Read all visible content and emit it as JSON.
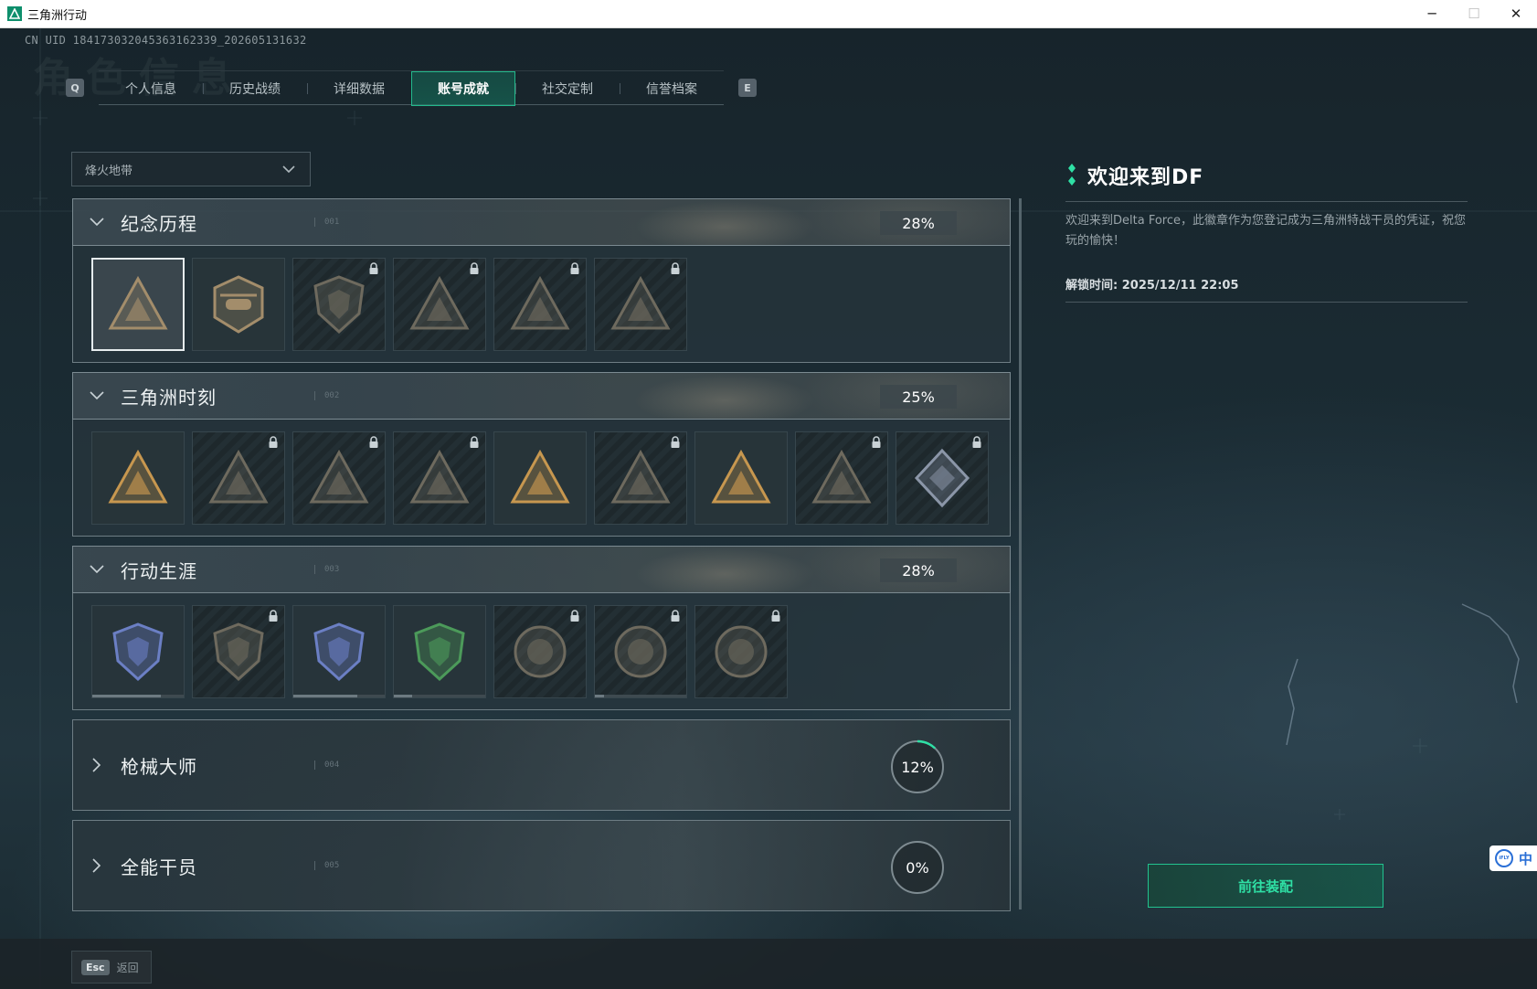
{
  "window": {
    "title": "三角洲行动",
    "controls": [
      "minimize",
      "maximize",
      "close"
    ]
  },
  "header": {
    "uid": "CN UID 184173032045363162339_202605131632",
    "watermark": "角色信息"
  },
  "tabs": {
    "prev_key": "Q",
    "next_key": "E",
    "items": [
      {
        "label": "个人信息",
        "active": false
      },
      {
        "label": "历史战绩",
        "active": false
      },
      {
        "label": "详细数据",
        "active": false
      },
      {
        "label": "账号成就",
        "active": true
      },
      {
        "label": "社交定制",
        "active": false
      },
      {
        "label": "信誉档案",
        "active": false
      }
    ]
  },
  "mode_select": {
    "value": "烽火地带"
  },
  "categories": [
    {
      "title": "纪念历程",
      "code": "001",
      "percent": "28%",
      "expanded": true,
      "badges": [
        {
          "icon": "delta-triangle-badge-icon",
          "locked": false,
          "selected": true,
          "color": "#a38d6b"
        },
        {
          "icon": "helicopter-badge-icon",
          "locked": false,
          "selected": false,
          "color": "#a38d6b"
        },
        {
          "icon": "diamond-shield-badge-icon",
          "locked": true,
          "color": "#6e6a5e"
        },
        {
          "icon": "gunner-badge-icon",
          "locked": true,
          "color": "#6e6a5e"
        },
        {
          "icon": "hooded-figure-badge-icon",
          "locked": true,
          "color": "#6e6a5e"
        },
        {
          "icon": "skull-crossed-rifles-badge-icon",
          "locked": true,
          "color": "#6e6a5e"
        }
      ]
    },
    {
      "title": "三角洲时刻",
      "code": "002",
      "percent": "25%",
      "expanded": true,
      "badges": [
        {
          "icon": "usb-drive-badge-icon",
          "locked": false,
          "color": "#c7974f"
        },
        {
          "icon": "robot-badge-icon",
          "locked": true,
          "color": "#6e6a5e"
        },
        {
          "icon": "kneeling-soldier-badge-icon",
          "locked": true,
          "color": "#6e6a5e"
        },
        {
          "icon": "sunburst-badge-icon",
          "locked": true,
          "color": "#6e6a5e"
        },
        {
          "icon": "hands-up-soldier-badge-icon",
          "locked": false,
          "color": "#c7974f"
        },
        {
          "icon": "wolf-badge-icon",
          "locked": true,
          "color": "#6e6a5e"
        },
        {
          "icon": "rocket-badge-icon",
          "locked": false,
          "color": "#c7974f"
        },
        {
          "icon": "fish-badge-icon",
          "locked": true,
          "color": "#6e6a5e"
        },
        {
          "icon": "dice-badge-icon",
          "locked": true,
          "color": "#8b96a8"
        }
      ]
    },
    {
      "title": "行动生涯",
      "code": "003",
      "percent": "28%",
      "expanded": true,
      "badges": [
        {
          "icon": "star-shield-badge-icon",
          "locked": false,
          "color": "#6b7fc4",
          "progress": 0.75
        },
        {
          "icon": "bronze-eagle-badge-icon",
          "locked": true,
          "color": "#6e6a5e"
        },
        {
          "icon": "blue-police-badge-icon",
          "locked": false,
          "color": "#6b7fc4",
          "progress": 0.7
        },
        {
          "icon": "green-shield-badge-icon",
          "locked": false,
          "color": "#4c9a5a",
          "progress": 0.2
        },
        {
          "icon": "helmet-medal-badge-icon",
          "locked": true,
          "color": "#6e6a5e"
        },
        {
          "icon": "skull-medal-badge-icon",
          "locked": true,
          "color": "#6e6a5e",
          "progress": 0.1
        },
        {
          "icon": "eye-medal-badge-icon",
          "locked": true,
          "color": "#6e6a5e"
        }
      ]
    },
    {
      "title": "枪械大师",
      "code": "004",
      "percent": "12%",
      "progress": 0.12,
      "expanded": false
    },
    {
      "title": "全能干员",
      "code": "005",
      "percent": "0%",
      "progress": 0,
      "expanded": false
    }
  ],
  "detail": {
    "title": "欢迎来到DF",
    "description": "欢迎来到Delta Force，此徽章作为您登记成为三角洲特战干员的凭证，祝您玩的愉快！",
    "unlock_label": "解锁时间: 2025/12/11 22:05"
  },
  "equip_button": {
    "label": "前往装配"
  },
  "footer": {
    "esc_key": "Esc",
    "back_label": "返回"
  },
  "ime": {
    "brand": "iFLY",
    "mode": "中"
  },
  "colors": {
    "accent": "#23b98c",
    "accent_text": "#2fe0a5",
    "background": "#1b2c34"
  }
}
